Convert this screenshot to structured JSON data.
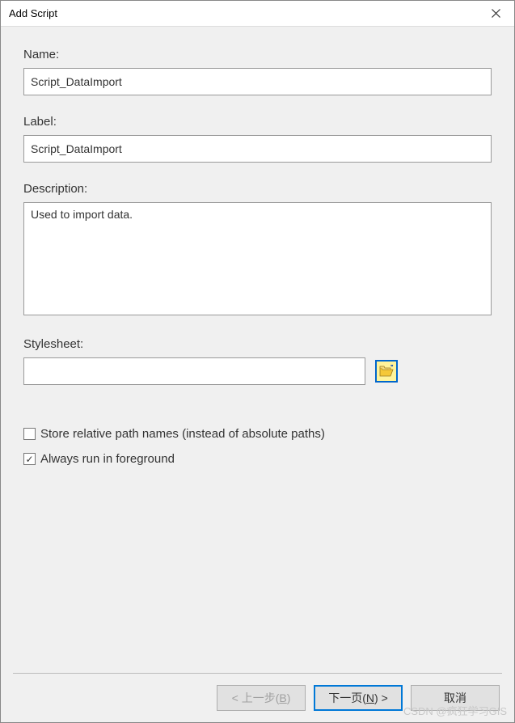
{
  "window": {
    "title": "Add Script"
  },
  "fields": {
    "name": {
      "label": "Name:",
      "value": "Script_DataImport"
    },
    "label": {
      "label": "Label:",
      "value": "Script_DataImport"
    },
    "description": {
      "label": "Description:",
      "value": "Used to import data."
    },
    "stylesheet": {
      "label": "Stylesheet:",
      "value": ""
    }
  },
  "checkboxes": {
    "relative_path": {
      "label": "Store relative path names (instead of absolute paths)",
      "checked": false
    },
    "foreground": {
      "label": "Always run in foreground",
      "checked": true
    }
  },
  "buttons": {
    "back": {
      "prefix": "< 上一步(",
      "key": "B",
      "suffix": ")"
    },
    "next": {
      "prefix": "下一页(",
      "key": "N",
      "suffix": ") >"
    },
    "cancel": "取消"
  },
  "watermark": "CSDN @疯狂学习GIS"
}
